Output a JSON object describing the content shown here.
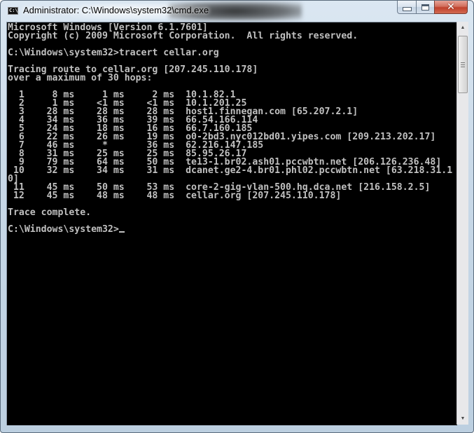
{
  "window": {
    "title": "Administrator: C:\\Windows\\system32\\cmd.exe",
    "app_icon_text": "C:\\.",
    "controls": {
      "minimize": "minimize",
      "maximize": "maximize",
      "close": "✕"
    }
  },
  "console": {
    "lines": [
      "Microsoft Windows [Version 6.1.7601]",
      "Copyright (c) 2009 Microsoft Corporation.  All rights reserved.",
      "",
      "C:\\Windows\\system32>tracert cellar.org",
      "",
      "Tracing route to cellar.org [207.245.110.178]",
      "over a maximum of 30 hops:",
      "",
      "  1     8 ms     1 ms     2 ms  10.1.82.1",
      "  2     1 ms    <1 ms    <1 ms  10.1.201.25",
      "  3    28 ms    28 ms    28 ms  host1.finnegan.com [65.207.2.1]",
      "  4    34 ms    36 ms    39 ms  66.54.166.114",
      "  5    24 ms    18 ms    16 ms  66.7.160.185",
      "  6    22 ms    26 ms    19 ms  o0-2bd3.nyc012bd01.yipes.com [209.213.202.17]",
      "  7    46 ms     *       36 ms  62.216.147.185",
      "  8    31 ms    25 ms    25 ms  85.95.26.17",
      "  9    79 ms    64 ms    50 ms  te13-1.br02.ash01.pccwbtn.net [206.126.236.48]",
      " 10    32 ms    34 ms    31 ms  dcanet.ge2-4.br01.phl02.pccwbtn.net [63.218.31.1",
      "0]",
      " 11    45 ms    50 ms    53 ms  core-2-gig-vlan-500.hq.dca.net [216.158.2.5]",
      " 12    45 ms    48 ms    48 ms  cellar.org [207.245.110.178]",
      "",
      "Trace complete.",
      "",
      "C:\\Windows\\system32>"
    ],
    "hops": [
      {
        "hop": "1",
        "rtt1": "8 ms",
        "rtt2": "1 ms",
        "rtt3": "2 ms",
        "host": "10.1.82.1"
      },
      {
        "hop": "2",
        "rtt1": "1 ms",
        "rtt2": "<1 ms",
        "rtt3": "<1 ms",
        "host": "10.1.201.25"
      },
      {
        "hop": "3",
        "rtt1": "28 ms",
        "rtt2": "28 ms",
        "rtt3": "28 ms",
        "host": "host1.finnegan.com [65.207.2.1]"
      },
      {
        "hop": "4",
        "rtt1": "34 ms",
        "rtt2": "36 ms",
        "rtt3": "39 ms",
        "host": "66.54.166.114"
      },
      {
        "hop": "5",
        "rtt1": "24 ms",
        "rtt2": "18 ms",
        "rtt3": "16 ms",
        "host": "66.7.160.185"
      },
      {
        "hop": "6",
        "rtt1": "22 ms",
        "rtt2": "26 ms",
        "rtt3": "19 ms",
        "host": "o0-2bd3.nyc012bd01.yipes.com [209.213.202.17]"
      },
      {
        "hop": "7",
        "rtt1": "46 ms",
        "rtt2": "*",
        "rtt3": "36 ms",
        "host": "62.216.147.185"
      },
      {
        "hop": "8",
        "rtt1": "31 ms",
        "rtt2": "25 ms",
        "rtt3": "25 ms",
        "host": "85.95.26.17"
      },
      {
        "hop": "9",
        "rtt1": "79 ms",
        "rtt2": "64 ms",
        "rtt3": "50 ms",
        "host": "te13-1.br02.ash01.pccwbtn.net [206.126.236.48]"
      },
      {
        "hop": "10",
        "rtt1": "32 ms",
        "rtt2": "34 ms",
        "rtt3": "31 ms",
        "host": "dcanet.ge2-4.br01.phl02.pccwbtn.net [63.218.31.10]"
      },
      {
        "hop": "11",
        "rtt1": "45 ms",
        "rtt2": "50 ms",
        "rtt3": "53 ms",
        "host": "core-2-gig-vlan-500.hq.dca.net [216.158.2.5]"
      },
      {
        "hop": "12",
        "rtt1": "45 ms",
        "rtt2": "48 ms",
        "rtt3": "48 ms",
        "host": "cellar.org [207.245.110.178]"
      }
    ],
    "prompt": "C:\\Windows\\system32>",
    "command": "tracert cellar.org",
    "target": "cellar.org [207.245.110.178]",
    "max_hops": "30",
    "status": "Trace complete."
  },
  "scrollbar": {
    "up_arrow": "▲",
    "down_arrow": "▼"
  }
}
